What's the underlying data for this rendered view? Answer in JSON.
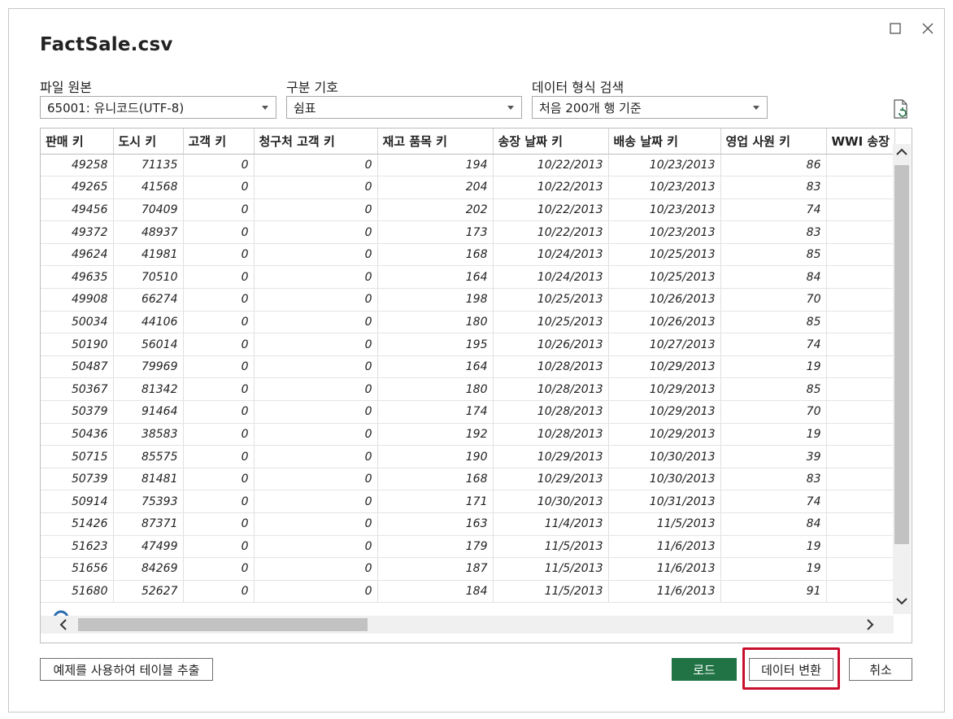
{
  "dialog": {
    "title": "FactSale.csv"
  },
  "window_controls": {
    "maximize_icon": "maximize-icon",
    "close_icon": "close-icon"
  },
  "options": {
    "file_origin": {
      "label": "파일 원본",
      "value": "65001: 유니코드(UTF-8)"
    },
    "delimiter": {
      "label": "구분 기호",
      "value": "쉼표"
    },
    "data_type_detection": {
      "label": "데이터 형식 검색",
      "value": "처음 200개 행 기준"
    },
    "refresh_icon": "refresh-document-icon"
  },
  "table": {
    "columns": [
      "판매 키",
      "도시 키",
      "고객 키",
      "청구처 고객 키",
      "재고 품목 키",
      "송장 날짜 키",
      "배송 날짜 키",
      "영업 사원 키",
      "WWI 송장 II"
    ],
    "rows": [
      [
        "49258",
        "71135",
        "0",
        "0",
        "194",
        "10/22/2013",
        "10/23/2013",
        "86",
        ""
      ],
      [
        "49265",
        "41568",
        "0",
        "0",
        "204",
        "10/22/2013",
        "10/23/2013",
        "83",
        ""
      ],
      [
        "49456",
        "70409",
        "0",
        "0",
        "202",
        "10/22/2013",
        "10/23/2013",
        "74",
        ""
      ],
      [
        "49372",
        "48937",
        "0",
        "0",
        "173",
        "10/22/2013",
        "10/23/2013",
        "83",
        ""
      ],
      [
        "49624",
        "41981",
        "0",
        "0",
        "168",
        "10/24/2013",
        "10/25/2013",
        "85",
        ""
      ],
      [
        "49635",
        "70510",
        "0",
        "0",
        "164",
        "10/24/2013",
        "10/25/2013",
        "84",
        ""
      ],
      [
        "49908",
        "66274",
        "0",
        "0",
        "198",
        "10/25/2013",
        "10/26/2013",
        "70",
        ""
      ],
      [
        "50034",
        "44106",
        "0",
        "0",
        "180",
        "10/25/2013",
        "10/26/2013",
        "85",
        ""
      ],
      [
        "50190",
        "56014",
        "0",
        "0",
        "195",
        "10/26/2013",
        "10/27/2013",
        "74",
        ""
      ],
      [
        "50487",
        "79969",
        "0",
        "0",
        "164",
        "10/28/2013",
        "10/29/2013",
        "19",
        ""
      ],
      [
        "50367",
        "81342",
        "0",
        "0",
        "180",
        "10/28/2013",
        "10/29/2013",
        "85",
        ""
      ],
      [
        "50379",
        "91464",
        "0",
        "0",
        "174",
        "10/28/2013",
        "10/29/2013",
        "70",
        ""
      ],
      [
        "50436",
        "38583",
        "0",
        "0",
        "192",
        "10/28/2013",
        "10/29/2013",
        "19",
        ""
      ],
      [
        "50715",
        "85575",
        "0",
        "0",
        "190",
        "10/29/2013",
        "10/30/2013",
        "39",
        ""
      ],
      [
        "50739",
        "81481",
        "0",
        "0",
        "168",
        "10/29/2013",
        "10/30/2013",
        "83",
        ""
      ],
      [
        "50914",
        "75393",
        "0",
        "0",
        "171",
        "10/30/2013",
        "10/31/2013",
        "74",
        ""
      ],
      [
        "51426",
        "87371",
        "0",
        "0",
        "163",
        "11/4/2013",
        "11/5/2013",
        "84",
        ""
      ],
      [
        "51623",
        "47499",
        "0",
        "0",
        "179",
        "11/5/2013",
        "11/6/2013",
        "19",
        ""
      ],
      [
        "51656",
        "84269",
        "0",
        "0",
        "187",
        "11/5/2013",
        "11/6/2013",
        "19",
        ""
      ],
      [
        "51680",
        "52627",
        "0",
        "0",
        "184",
        "11/5/2013",
        "11/6/2013",
        "91",
        ""
      ]
    ]
  },
  "buttons": {
    "extract": "예제를 사용하여 테이블 추출",
    "load": "로드",
    "transform": "데이터 변환",
    "cancel": "취소"
  },
  "colors": {
    "load_button": "#217346",
    "highlight_outline": "#c8102e"
  }
}
